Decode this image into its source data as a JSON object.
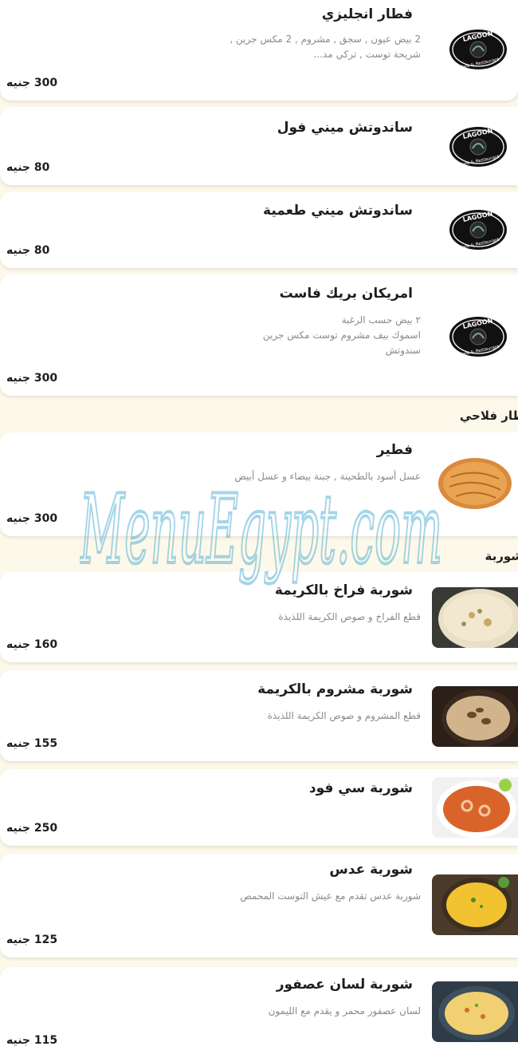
{
  "header": {
    "accent_color": "#d32f2f"
  },
  "items_top": [
    {
      "name": "فطار انجليزي",
      "description": "2 بيض عيون , سجق , مشروم , 2 مكس جرين , شريحة توست , تركي مد...",
      "price": "300 جنيه",
      "image": "lagoon-logo"
    },
    {
      "name": "ساندوتش ميني فول",
      "description": "",
      "price": "80 جنيه",
      "image": "lagoon-logo"
    },
    {
      "name": "ساندوتش ميني طعمية",
      "description": "",
      "price": "80 جنيه",
      "image": "lagoon-logo"
    },
    {
      "name": "امريكان بريك فاست",
      "description": "٢ بيض حسب الرغبة\nاسموك بيف مشروم توست مكس جرين\nسندوتش",
      "price": "300 جنيه",
      "image": "lagoon-logo"
    }
  ],
  "logo_text": {
    "top": "LAGOON",
    "bottom": "Cafe & Restaurant"
  },
  "sections": {
    "fallahi": "فطار فلاحي",
    "soup": "شوربة"
  },
  "fallahi_items": [
    {
      "name": "فطير",
      "description": "عسل أسود بالطحينة , جبنة بيضاء و عسل أبيض",
      "price": "300 جنيه",
      "image": "feteer-photo"
    }
  ],
  "soup_items": [
    {
      "name": "شوربة فراخ بالكريمة",
      "description": "قطع الفراخ و صوص الكريمة اللذيذة",
      "price": "160 جنيه",
      "image": "chicken-cream-soup-photo"
    },
    {
      "name": "شوربة مشروم بالكريمة",
      "description": "قطع المشروم و صوص الكريمة اللذيذة",
      "price": "155 جنيه",
      "image": "mushroom-soup-photo"
    },
    {
      "name": "شوربة سي فود",
      "description": "",
      "price": "250 جنيه",
      "image": "seafood-soup-photo"
    },
    {
      "name": "شوربة عدس",
      "description": "شوربة عدس تقدم مع عيش التوست المحمص",
      "price": "125 جنيه",
      "image": "lentil-soup-photo"
    },
    {
      "name": "شوربة لسان عصفور",
      "description": "لسان عصفور محمر و يقدم مع الليمون",
      "price": "115 جنيه",
      "image": "orzo-soup-photo"
    }
  ],
  "watermark": {
    "text": "MenuEgypt.com",
    "color": "#5bb3d6"
  }
}
